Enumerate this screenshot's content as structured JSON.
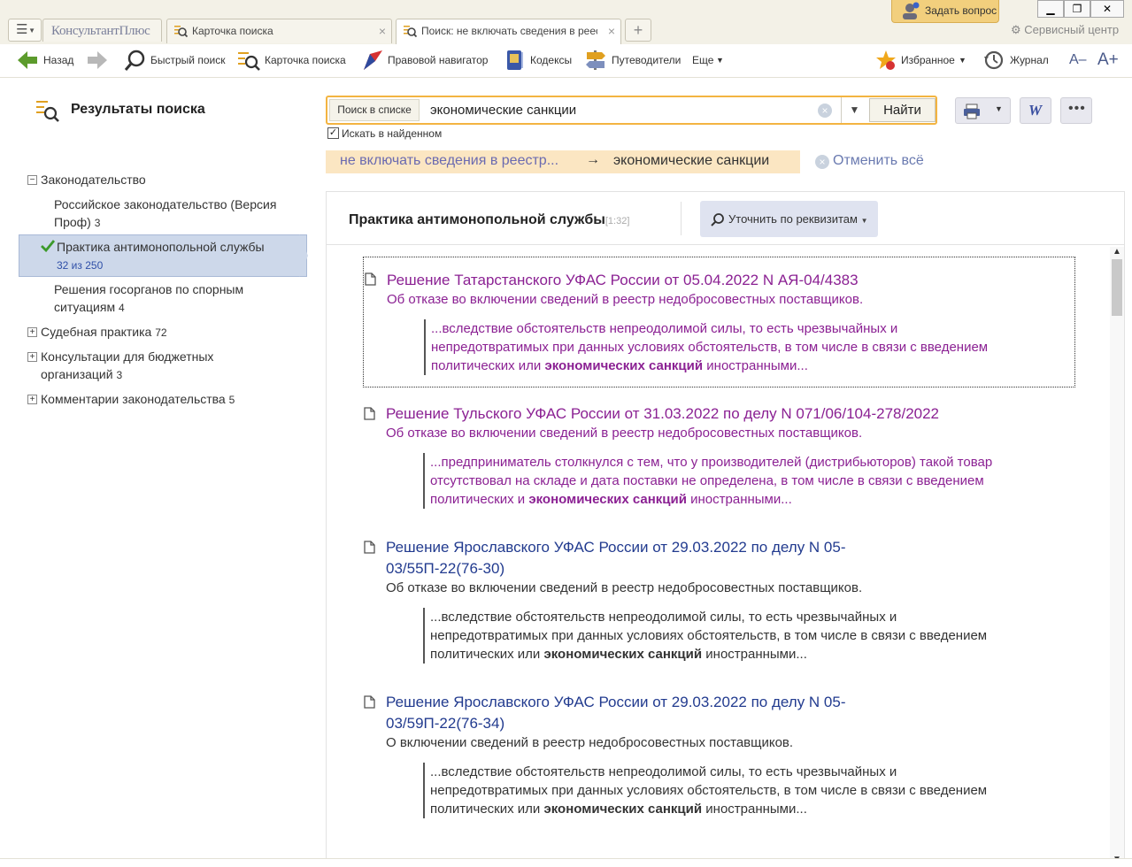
{
  "tabbar": {
    "logo": "КонсультантПлюс",
    "tabs": [
      {
        "label": "Карточка поиска"
      },
      {
        "label": "Поиск: не включать сведения в реестр"
      }
    ],
    "ask_button": "Задать вопрос",
    "service_center": "Сервисный центр"
  },
  "toolbar": {
    "back": "Назад",
    "quick_search": "Быстрый поиск",
    "search_card": "Карточка поиска",
    "legal_navigator": "Правовой навигатор",
    "codes": "Кодексы",
    "guides": "Путеводители",
    "more": "Еще",
    "favorites": "Избранное",
    "journal": "Журнал",
    "font_smaller": "A–",
    "font_larger": "A+"
  },
  "sidebar": {
    "title": "Результаты поиска",
    "groups": [
      {
        "label": "Законодательство",
        "expanded": true
      },
      {
        "label": "Судебная практика",
        "count": "72"
      },
      {
        "label": "Консультации для бюджетных организаций",
        "count": "3"
      },
      {
        "label": "Комментарии законодательства",
        "count": "5"
      }
    ],
    "items": [
      {
        "label": "Российское законодательство (Версия Проф)",
        "count": "3"
      },
      {
        "label": "Практика антимонопольной службы",
        "count": "32 из 250"
      },
      {
        "label": "Решения госорганов по спорным ситуациям",
        "count": "4"
      }
    ]
  },
  "search": {
    "mode": "Поиск в списке",
    "value": "экономические санкции",
    "find": "Найти",
    "search_in_found": "Искать в найденном",
    "search_in_found_checked": true,
    "crumb_first": "не включать сведения в реестр...",
    "crumb_arrow": "→",
    "crumb_second": "экономические санкции",
    "cancel_all": "Отменить всё"
  },
  "results": {
    "title": "Практика антимонопольной службы",
    "time": "[1:32]",
    "refine": "Уточнить по реквизитам",
    "docs": [
      {
        "title": "Решение Татарстанского УФАС России от 05.04.2022 N АЯ-04/4383",
        "subtitle": "Об отказе во включении сведений в реестр недобросовестных поставщиков.",
        "snippet_pre": "...вследствие обстоятельств непреодолимой силы, то есть чрезвычайных и непредотвратимых при данных условиях обстоятельств, в том числе в связи с введением политических или ",
        "snippet_bold": "экономических санкций",
        "snippet_post": " иностранными...",
        "visited": true
      },
      {
        "title": "Решение Тульского УФАС России от 31.03.2022 по делу N 071/06/104-278/2022",
        "subtitle": "Об отказе во включении сведений в реестр недобросовестных поставщиков.",
        "snippet_pre": "...предприниматель столкнулся с тем, что у производителей (дистрибьюторов) такой товар отсутствовал на складе и дата поставки не определена, в том числе в связи с введением политических и ",
        "snippet_bold": "экономических санкций",
        "snippet_post": " иностранными...",
        "visited": true
      },
      {
        "title": "Решение Ярославского УФАС России от 29.03.2022 по делу N 05-03/55П-22(76-30)",
        "subtitle": "Об отказе во включении сведений в реестр недобросовестных поставщиков.",
        "snippet_pre": "...вследствие обстоятельств непреодолимой силы, то есть чрезвычайных и непредотвратимых при данных условиях обстоятельств, в том числе в связи с введением политических или ",
        "snippet_bold": "экономических санкций",
        "snippet_post": " иностранными...",
        "visited": false
      },
      {
        "title": "Решение Ярославского УФАС России от 29.03.2022 по делу N 05-03/59П-22(76-34)",
        "subtitle": "О включении сведений в реестр недобросовестных поставщиков.",
        "snippet_pre": "...вследствие обстоятельств непреодолимой силы, то есть чрезвычайных и непредотвратимых при данных условиях обстоятельств, в том числе в связи с введением политических или ",
        "snippet_bold": "экономических санкций",
        "snippet_post": " иностранными...",
        "visited": false
      }
    ]
  },
  "colors": {
    "accent": "#f3b441",
    "visited_link": "#8b2193",
    "link": "#223b8f",
    "selection": "#cdd8ea"
  }
}
